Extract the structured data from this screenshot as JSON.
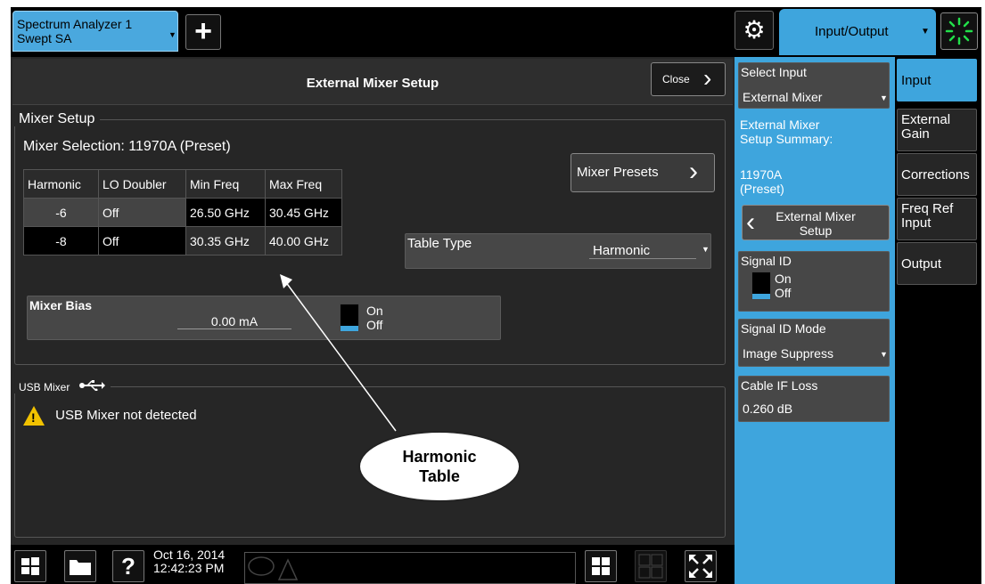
{
  "topbar": {
    "measurement_tab": {
      "line1": "Spectrum Analyzer 1",
      "line2": "Swept SA"
    },
    "add_label": "+",
    "menu_title": "Input/Output"
  },
  "dialog": {
    "title": "External Mixer Setup",
    "close_label": "Close",
    "mixer_setup": {
      "group_label": "Mixer Setup",
      "mixer_selection": "Mixer Selection:  11970A (Preset)",
      "presets_label": "Mixer Presets",
      "table": {
        "headers": [
          "Harmonic",
          "LO Doubler",
          "Min Freq",
          "Max Freq"
        ],
        "rows": [
          [
            "-6",
            "Off",
            "26.50 GHz",
            "30.45 GHz"
          ],
          [
            "-8",
            "Off",
            "30.35 GHz",
            "40.00 GHz"
          ]
        ]
      },
      "table_type": {
        "label": "Table Type",
        "value": "Harmonic"
      },
      "mixer_bias": {
        "label": "Mixer Bias",
        "value": "0.00 mA",
        "on": "On",
        "off": "Off"
      }
    },
    "usb_mixer": {
      "group_label": "USB Mixer",
      "status": "USB Mixer not detected"
    }
  },
  "callout": {
    "line1": "Harmonic",
    "line2": "Table"
  },
  "bottombar": {
    "date": "Oct 16, 2014",
    "time": "12:42:23 PM"
  },
  "right_panel": {
    "select_input": {
      "label": "Select Input",
      "value": "External Mixer"
    },
    "summary_title_1": "External Mixer",
    "summary_title_2": "Setup Summary:",
    "summary_value_1": "11970A",
    "summary_value_2": "(Preset)",
    "back_label_1": "External Mixer",
    "back_label_2": "Setup",
    "signal_id": {
      "label": "Signal ID",
      "on": "On",
      "off": "Off"
    },
    "signal_id_mode": {
      "label": "Signal ID Mode",
      "value": "Image Suppress"
    },
    "cable_if_loss": {
      "label": "Cable IF Loss",
      "value": "0.260 dB"
    }
  },
  "right_tabs": [
    {
      "line1": "Input",
      "line2": ""
    },
    {
      "line1": "External",
      "line2": "Gain"
    },
    {
      "line1": "Corrections",
      "line2": ""
    },
    {
      "line1": "Freq Ref",
      "line2": "Input"
    },
    {
      "line1": "Output",
      "line2": ""
    }
  ],
  "colors": {
    "accent": "#3ea5dd",
    "warning": "#f2c200",
    "panel": "#474747"
  }
}
